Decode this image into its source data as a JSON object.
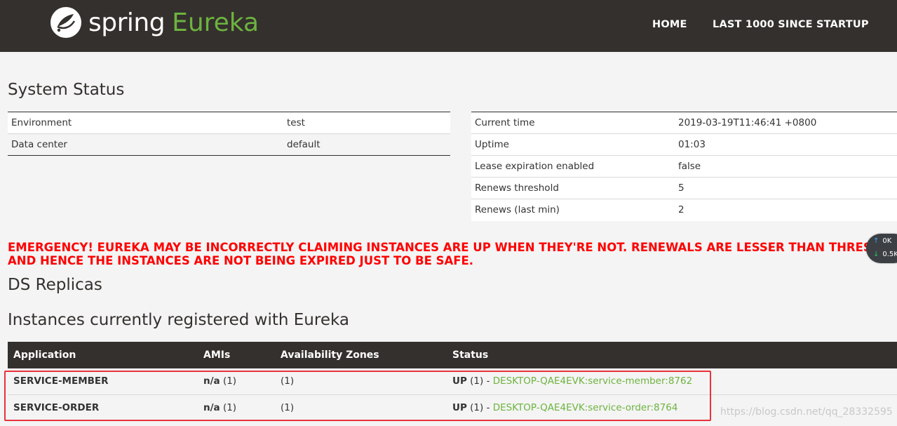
{
  "header": {
    "brand_spring": "spring",
    "brand_eureka": "Eureka",
    "nav": [
      "HOME",
      "LAST 1000 SINCE STARTUP"
    ],
    "logo_icon": "spring-leaf-icon"
  },
  "system_status": {
    "title": "System Status",
    "left": [
      {
        "key": "Environment",
        "value": "test"
      },
      {
        "key": "Data center",
        "value": "default"
      }
    ],
    "right": [
      {
        "key": "Current time",
        "value": "2019-03-19T11:46:41 +0800"
      },
      {
        "key": "Uptime",
        "value": "01:03"
      },
      {
        "key": "Lease expiration enabled",
        "value": "false"
      },
      {
        "key": "Renews threshold",
        "value": "5"
      },
      {
        "key": "Renews (last min)",
        "value": "2"
      }
    ]
  },
  "emergency": {
    "line1": "EMERGENCY! EUREKA MAY BE INCORRECTLY CLAIMING INSTANCES ARE UP WHEN THEY'RE NOT. RENEWALS ARE LESSER THAN THRESHOLD",
    "line2": "AND HENCE THE INSTANCES ARE NOT BEING EXPIRED JUST TO BE SAFE."
  },
  "replicas": {
    "title": "DS Replicas"
  },
  "instances": {
    "title": "Instances currently registered with Eureka",
    "headers": [
      "Application",
      "AMIs",
      "Availability Zones",
      "Status"
    ],
    "rows": [
      {
        "application": "SERVICE-MEMBER",
        "ami_bold": "n/a",
        "ami_count": " (1)",
        "zones": "(1)",
        "status_bold": "UP",
        "status_count": " (1) - ",
        "instance": "DESKTOP-QAE4EVK:service-member:8762"
      },
      {
        "application": "SERVICE-ORDER",
        "ami_bold": "n/a",
        "ami_count": " (1)",
        "zones": "(1)",
        "status_bold": "UP",
        "status_count": " (1) - ",
        "instance": "DESKTOP-QAE4EVK:service-order:8764"
      }
    ]
  },
  "speed_widget": {
    "up": "0K",
    "down": "0.5K"
  },
  "watermark": "https://blog.csdn.net/qq_28332595",
  "colors": {
    "navbar": "#34302d",
    "brand_green": "#6db33f",
    "emergency_red": "#ff0000",
    "highlight_red": "#e8323c"
  }
}
